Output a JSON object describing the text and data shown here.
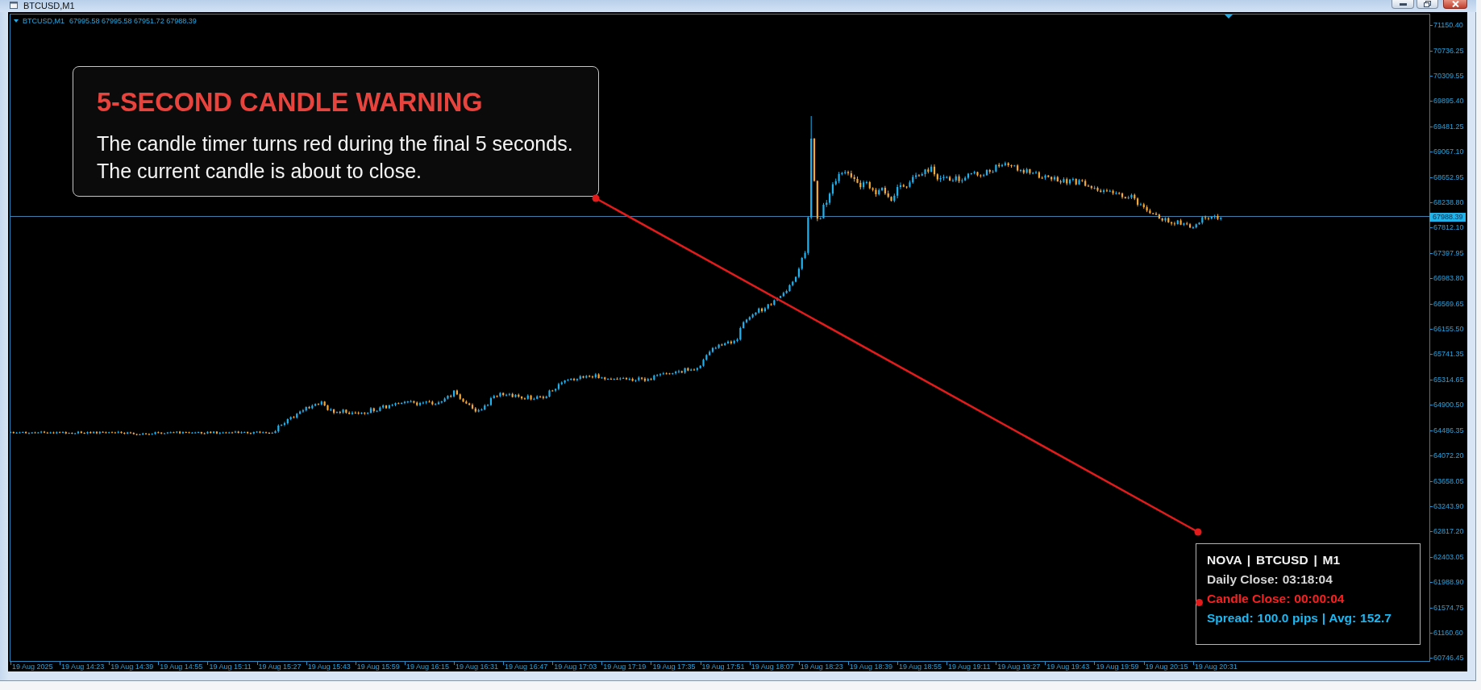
{
  "window": {
    "title": "BTCUSD,M1"
  },
  "chart": {
    "symbol": "BTCUSD,M1",
    "ohlc": "67995.58 67995.58 67951.72 67988.39",
    "current_price": "67988.39",
    "price_axis": [
      "71150.40",
      "70736.25",
      "70309.55",
      "69895.40",
      "69481.25",
      "69067.10",
      "68652.95",
      "68238.80",
      "67812.10",
      "67397.95",
      "66983.80",
      "66569.65",
      "66155.50",
      "65741.35",
      "65314.65",
      "64900.50",
      "64486.35",
      "64072.20",
      "63658.05",
      "63243.90",
      "62817.20",
      "62403.05",
      "61988.90",
      "61574.75",
      "61160.60",
      "60746.45"
    ],
    "time_axis": [
      "19 Aug 2025",
      "19 Aug 14:23",
      "19 Aug 14:39",
      "19 Aug 14:55",
      "19 Aug 15:11",
      "19 Aug 15:27",
      "19 Aug 15:43",
      "19 Aug 15:59",
      "19 Aug 16:15",
      "19 Aug 16:31",
      "19 Aug 16:47",
      "19 Aug 17:03",
      "19 Aug 17:19",
      "19 Aug 17:35",
      "19 Aug 17:51",
      "19 Aug 18:07",
      "19 Aug 18:23",
      "19 Aug 18:39",
      "19 Aug 18:55",
      "19 Aug 19:11",
      "19 Aug 19:27",
      "19 Aug 19:43",
      "19 Aug 19:59",
      "19 Aug 20:15",
      "19 Aug 20:31"
    ]
  },
  "callout": {
    "title": "5-SECOND CANDLE WARNING",
    "lines": [
      "The candle timer turns red during the final 5 seconds.",
      "The current candle is about to close."
    ]
  },
  "info_panel": {
    "lines": [
      {
        "kind": "header",
        "text": "NOVA | BTCUSD | M1"
      },
      {
        "kind": "timer",
        "label": "Daily Close:",
        "value": "03:18:04",
        "warning": false
      },
      {
        "kind": "timer",
        "label": "Candle Close:",
        "value": "00:00:04",
        "warning": true
      },
      {
        "kind": "spread",
        "text": "Spread: 100.0 pips | Avg: 152.7"
      }
    ]
  }
}
